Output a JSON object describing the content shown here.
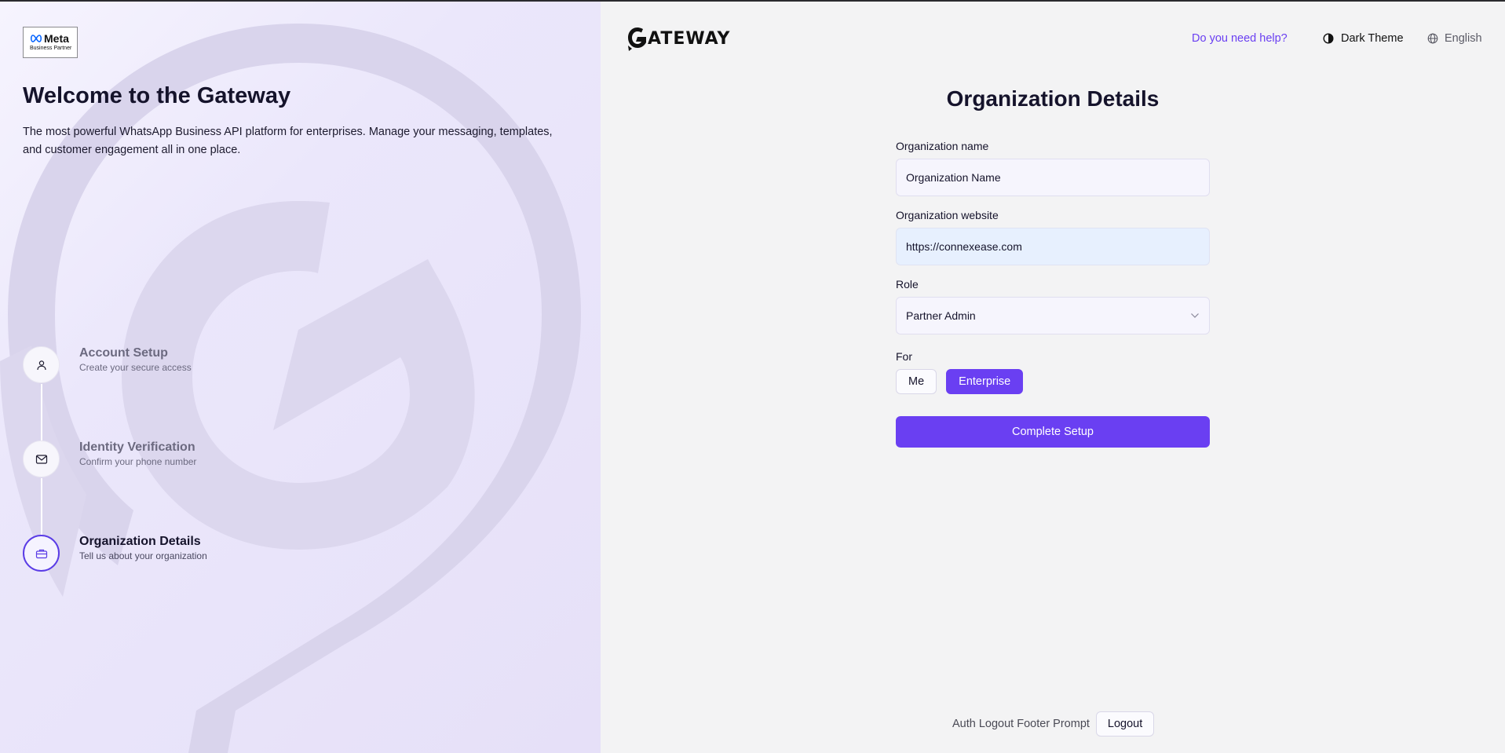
{
  "brand": {
    "partner_badge_word": "Meta",
    "partner_badge_sub": "Business Partner",
    "logo_text": "ATEWAY",
    "accent": "#6a3ff2"
  },
  "left": {
    "title": "Welcome to the Gateway",
    "intro": "The most powerful WhatsApp Business API platform for enterprises. Manage your messaging, templates, and customer engagement all in one place.",
    "steps": [
      {
        "title": "Account Setup",
        "desc": "Create your secure access",
        "icon": "user-icon",
        "state": "done"
      },
      {
        "title": "Identity Verification",
        "desc": "Confirm your phone number",
        "icon": "mail-icon",
        "state": "done"
      },
      {
        "title": "Organization Details",
        "desc": "Tell us about your organization",
        "icon": "briefcase-icon",
        "state": "current"
      }
    ]
  },
  "header": {
    "help": "Do you need help?",
    "theme": "Dark Theme",
    "language": "English"
  },
  "form": {
    "title": "Organization Details",
    "org_name_label": "Organization name",
    "org_name_placeholder": "Organization Name",
    "org_website_label": "Organization website",
    "org_website_value": "https://connexease.com",
    "role_label": "Role",
    "role_value": "Partner Admin",
    "for_label": "For",
    "for_options": [
      "Me",
      "Enterprise"
    ],
    "for_selected": "Enterprise",
    "submit": "Complete Setup"
  },
  "footer": {
    "prompt": "Auth Logout Footer Prompt",
    "logout": "Logout"
  }
}
